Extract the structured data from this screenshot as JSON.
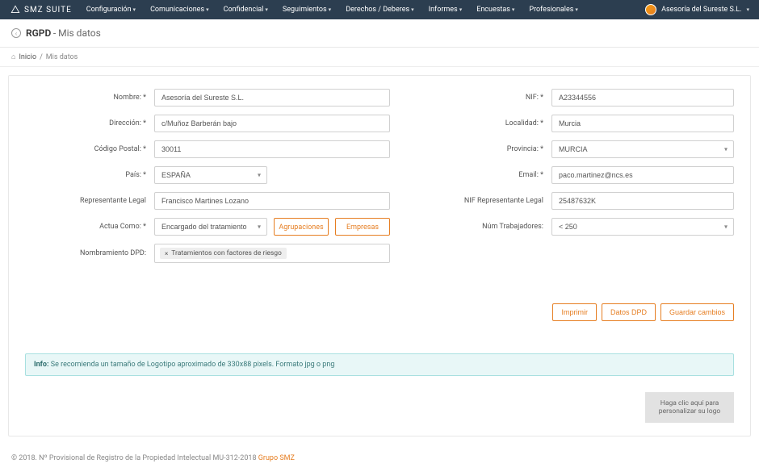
{
  "brand": "SMZ SUITE",
  "nav": [
    "Configuración",
    "Comunicaciones",
    "Confidencial",
    "Seguimientos",
    "Derechos / Deberes",
    "Informes",
    "Encuestas",
    "Profesionales"
  ],
  "account": "Asesoría del Sureste S.L.",
  "page": {
    "title_strong": "RGPD",
    "title_sub": "- Mis datos"
  },
  "breadcrumb": {
    "home": "Inicio",
    "current": "Mis datos"
  },
  "labels": {
    "nombre": "Nombre: *",
    "direccion": "Dirección: *",
    "cp": "Código Postal: *",
    "pais": "País: *",
    "rep_legal": "Representante Legal",
    "actua_como": "Actua Como: *",
    "nomb_dpd": "Nombramiento DPD:",
    "nif": "NIF: *",
    "localidad": "Localidad: *",
    "provincia": "Provincia: *",
    "email": "Email: *",
    "nif_rep": "NIF Representante Legal",
    "num_trab": "Núm Trabajadores:"
  },
  "values": {
    "nombre": "Asesoría del Sureste S.L.",
    "direccion": "c/Muñoz Barberán bajo",
    "cp": "30011",
    "pais": "ESPAÑA",
    "rep_legal": "Francisco Martines Lozano",
    "actua_como": "Encargado del tratamiento",
    "dpd_tag": "Tratamientos con factores de riesgo",
    "nif": "A23344556",
    "localidad": "Murcia",
    "provincia": "MURCIA",
    "email": "paco.martinez@ncs.es",
    "nif_rep": "25487632K",
    "num_trab": "< 250"
  },
  "buttons": {
    "agrupaciones": "Agrupaciones",
    "empresas": "Empresas",
    "imprimir": "Imprimir",
    "datos_dpd": "Datos DPD",
    "guardar": "Guardar cambios"
  },
  "info": {
    "label": "Info:",
    "text": "Se recomienda un tamaño de Logotipo aproximado de 330x88 pixels. Formato jpg o png"
  },
  "logo_drop": "Haga clic aquí para personalizar su logo",
  "footer": {
    "text": "© 2018. Nº Provisional de Registro de la Propiedad Intelectual MU-312-2018 ",
    "link": "Grupo SMZ"
  }
}
